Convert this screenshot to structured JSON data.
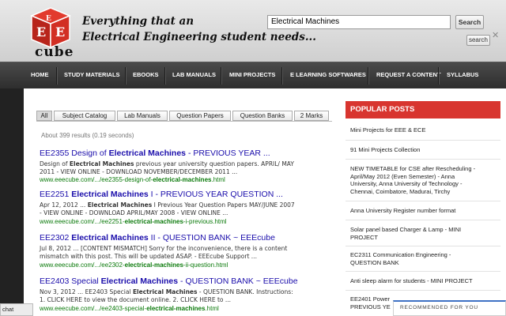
{
  "header": {
    "logo_text": "cube",
    "tagline_line1": "Everything that an",
    "tagline_line2": "Electrical Engineering student needs...",
    "search_value": "Electrical Machines",
    "search_button": "Search",
    "search_link": "search",
    "close_glyph": "✕"
  },
  "nav": {
    "items": [
      "HOME",
      "STUDY MATERIALS",
      "EBOOKS",
      "LAB MANUALS",
      "MINI PROJECTS",
      "E LEARNING SOFTWARES",
      "REQUEST A CONTENT",
      "SYLLABUS"
    ]
  },
  "tabs": [
    "All",
    "Subject Catalog",
    "Lab Manuals",
    "Question Papers",
    "Question Banks",
    "2 Marks"
  ],
  "results": {
    "count": "About 399 results (0.19 seconds)",
    "items": [
      {
        "title": "EE2355 Design of Electrical Machines - PREVIOUS YEAR ...",
        "snippet1": "Design of Electrical Machines previous year university question papers. APRIL/ MAY",
        "snippet2": "2011 - VIEW ONLINE - DOWNLOAD NOVEMBER/DECEMBER 2011 ...",
        "url": "www.eeecube.com/.../ee2355-design-of-electrical-machines.html"
      },
      {
        "title": "EE2251 Electrical Machines I - PREVIOUS YEAR QUESTION ...",
        "snippet1": "Apr 12, 2012 ... Electrical Machines I Previous Year Question Papers MAY/JUNE 2007",
        "snippet2": "- VIEW ONLINE - DOWNLOAD APRIL/MAY 2008 - VIEW ONLINE ...",
        "url": "www.eeecube.com/.../ee2251-electrical-machines-i-previous.html"
      },
      {
        "title": "EE2302 Electrical Machines II - QUESTION BANK ~ EEEcube",
        "snippet1": "Jul 8, 2012 ... [CONTENT MISMATCH] Sorry for the inconvenience, there is a content",
        "snippet2": "mismatch with this post. This will be updated ASAP. - EEEcube Support ...",
        "url": "www.eeecube.com/.../ee2302-electrical-machines-ii-question.html"
      },
      {
        "title": "EE2403 Special Electrical Machines - QUESTION BANK ~ EEEcube",
        "snippet1": "Nov 3, 2012 ... EE2403 Special Electrical Machines - QUESTION BANK. Instructions:",
        "snippet2": "1. CLICK HERE to view the document online. 2. CLICK HERE to ...",
        "url": "www.eeecube.com/.../ee2403-special-electrical-machines.html"
      }
    ]
  },
  "sidebar": {
    "title": "POPULAR POSTS",
    "posts": [
      [
        "Mini Projects for EEE & ECE"
      ],
      [
        "91 Mini Projects Collection"
      ],
      [
        "NEW TIMETABLE for CSE after Rescheduling -",
        "April/May 2012 (Even Semester) - Anna",
        "University, Anna University of Technology -",
        "Chennai, Coimbatore, Madurai, Tirchy"
      ],
      [
        "Anna University Register number format"
      ],
      [
        "Solar panel based Charger & Lamp - MINI",
        "PROJECT"
      ],
      [
        "EC2311 Communication Engineering -",
        "QUESTION BANK"
      ],
      [
        "Anti sleep alarm for students - MINI PROJECT"
      ],
      [
        "EE2401 Power",
        "PREVIOUS YE"
      ]
    ]
  },
  "overlays": {
    "chat": "chat",
    "recommended": "RECOMMENDED FOR YOU"
  },
  "colors": {
    "accent": "#d8352f",
    "link": "#1a0dab",
    "url": "#0b7a0b"
  }
}
